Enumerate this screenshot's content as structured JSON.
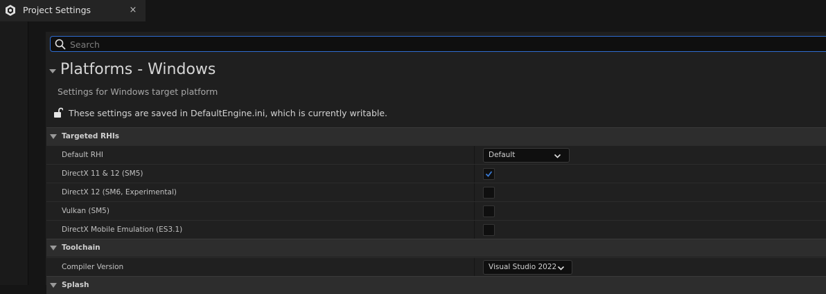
{
  "tab": {
    "label": "Project Settings",
    "close_label": "×"
  },
  "search": {
    "placeholder": "Search",
    "value": ""
  },
  "section": {
    "title": "Platforms - Windows",
    "subtitle": "Settings for Windows target platform",
    "save_note": "These settings are saved in DefaultEngine.ini, which is currently writable."
  },
  "categories": {
    "targeted_rhis": {
      "label": "Targeted RHIs",
      "rows": [
        {
          "label": "Default RHI",
          "control": "dropdown",
          "value": "Default"
        },
        {
          "label": "DirectX 11 & 12 (SM5)",
          "control": "checkbox",
          "checked": true
        },
        {
          "label": "DirectX 12 (SM6, Experimental)",
          "control": "checkbox",
          "checked": false
        },
        {
          "label": "Vulkan (SM5)",
          "control": "checkbox",
          "checked": false
        },
        {
          "label": "DirectX Mobile Emulation (ES3.1)",
          "control": "checkbox",
          "checked": false
        }
      ]
    },
    "toolchain": {
      "label": "Toolchain",
      "rows": [
        {
          "label": "Compiler Version",
          "control": "dropdown",
          "value": "Visual Studio 2022"
        }
      ]
    },
    "splash": {
      "label": "Splash"
    }
  },
  "colors": {
    "accent": "#2f6cd1",
    "check": "#3a7bd5"
  },
  "icons": {
    "tab": "unreal-settings-icon",
    "close": "close-icon",
    "search": "search-icon",
    "collapse": "collapse-arrow-icon",
    "lock": "unlocked-icon",
    "caret": "chevron-down-icon",
    "check": "checkmark-icon"
  }
}
